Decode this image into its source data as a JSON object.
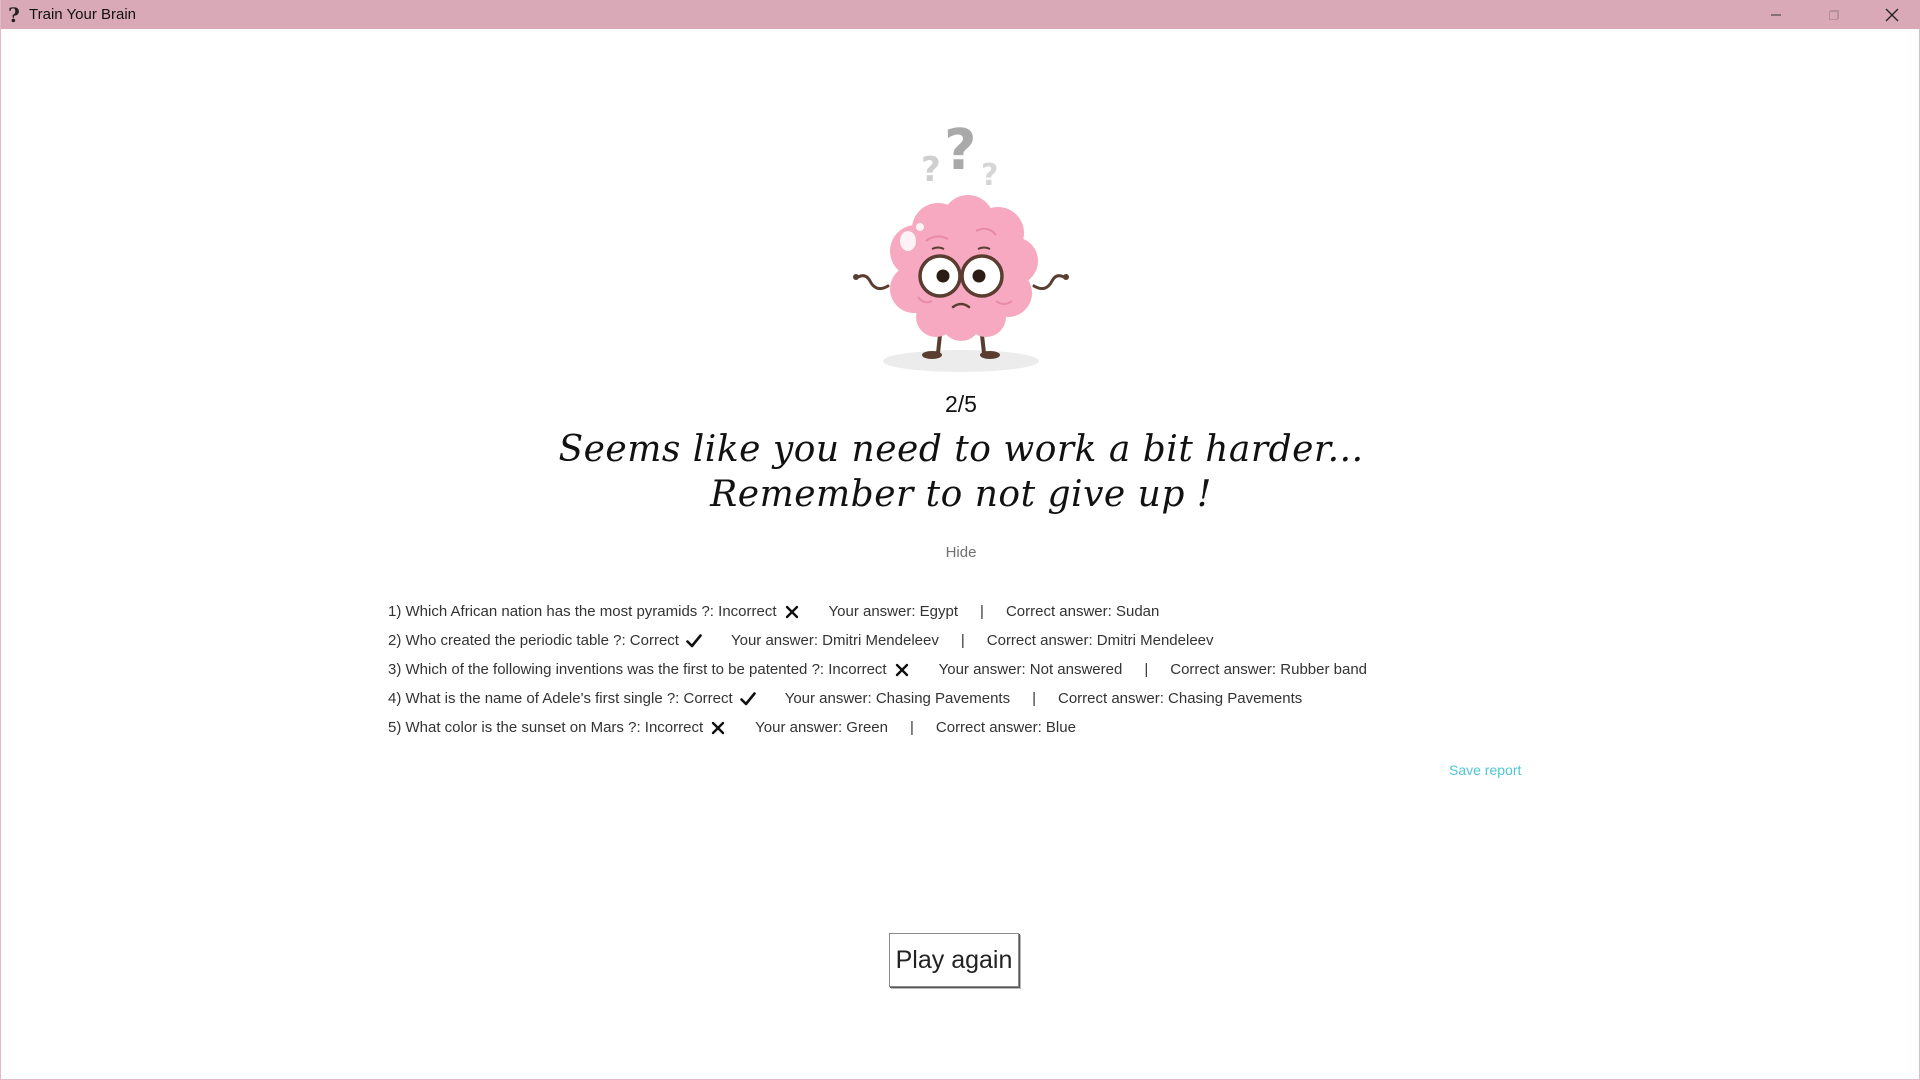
{
  "window": {
    "title": "Train Your Brain",
    "app_icon": "?",
    "controls": [
      "minimize-icon",
      "maximize-icon",
      "close-icon"
    ],
    "titlebar_color": "#d9a9b7"
  },
  "result": {
    "score": "2/5",
    "headline_line1": "Seems like you need to work a bit harder...",
    "headline_line2": "Remember to not give up !",
    "hide_label": "Hide",
    "save_report_label": "Save report",
    "play_again_label": "Play again",
    "link_color": "#4ec6d4"
  },
  "report": [
    {
      "question": "1) Which African nation has the most pyramids ?: Incorrect",
      "status": "incorrect",
      "your_answer": "Your answer: Egypt",
      "separator": "|",
      "correct_answer": "Correct answer: Sudan"
    },
    {
      "question": "2) Who created the periodic table ?: Correct",
      "status": "correct",
      "your_answer": "Your answer: Dmitri Mendeleev",
      "separator": "|",
      "correct_answer": "Correct answer: Dmitri Mendeleev"
    },
    {
      "question": "3) Which of the following inventions was the first to be patented ?: Incorrect",
      "status": "incorrect",
      "your_answer": "Your answer: Not answered",
      "separator": "|",
      "correct_answer": "Correct answer: Rubber band"
    },
    {
      "question": "4) What is the name of Adele's first single ?: Correct",
      "status": "correct",
      "your_answer": "Your answer: Chasing Pavements",
      "separator": "|",
      "correct_answer": "Correct answer: Chasing Pavements"
    },
    {
      "question": "5) What color is the sunset on Mars ?: Incorrect",
      "status": "incorrect",
      "your_answer": "Your answer: Green",
      "separator": "|",
      "correct_answer": "Correct answer: Blue"
    }
  ]
}
